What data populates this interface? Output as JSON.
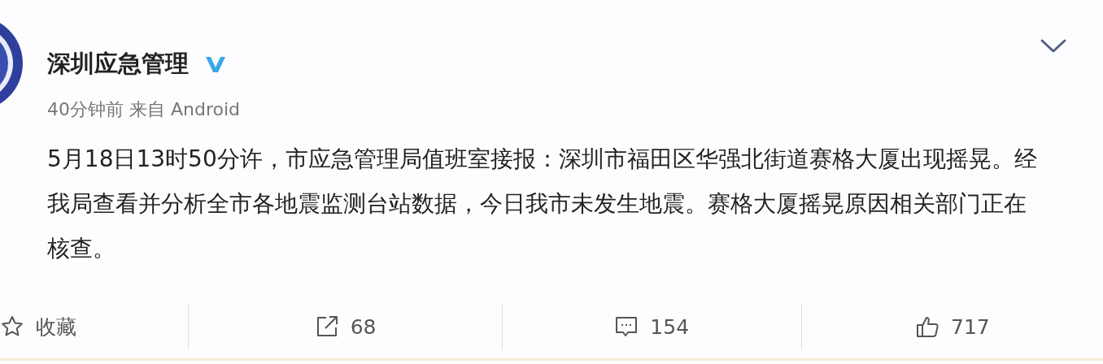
{
  "post": {
    "author": "深圳应急管理",
    "verified": true,
    "meta": "40分钟前 来自 Android",
    "text": "5月18日13时50分许，市应急管理局值班室接报：深圳市福田区华强北街道赛格大厦出现摇晃。经我局查看并分析全市各地震监测台站数据，今日我市未发生地震。赛格大厦摇晃原因相关部门正在核查。"
  },
  "actions": [
    {
      "kind": "favorite",
      "label": "收藏"
    },
    {
      "kind": "repost",
      "label": "68"
    },
    {
      "kind": "comment",
      "label": "154"
    },
    {
      "kind": "like",
      "label": "717"
    }
  ]
}
